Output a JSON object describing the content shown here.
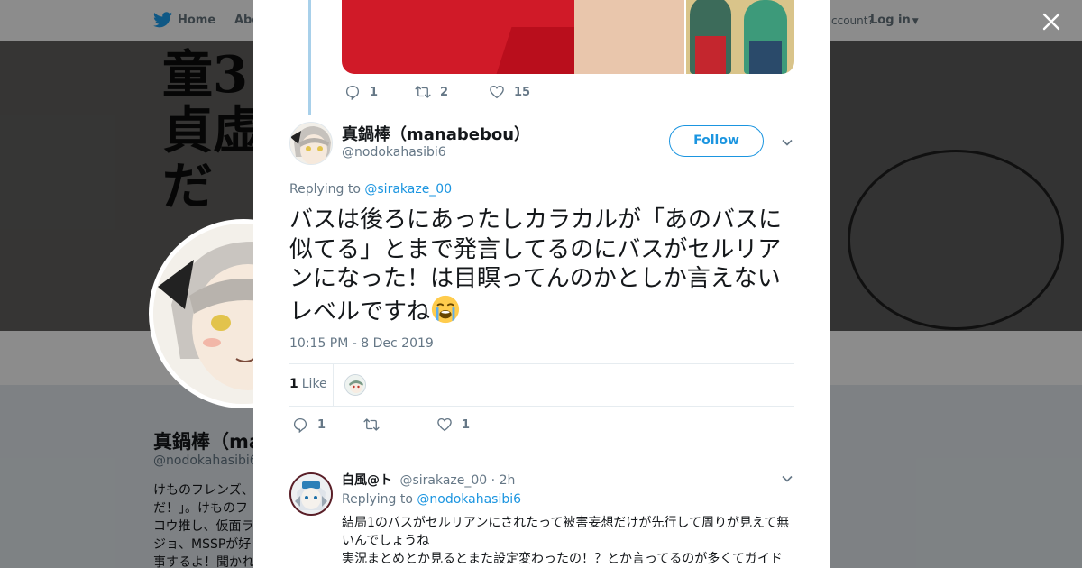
{
  "nav": {
    "home": "Home",
    "about": "Abo",
    "have_account": "ccount?",
    "login": "Log in"
  },
  "banner": {
    "kanji_lines": [
      "童3",
      "貞虚",
      "だ"
    ]
  },
  "background_profile": {
    "name": "真鍋棒（ma",
    "handle": "@nodokahasibi6",
    "bio": "けものフレンズ、だ！」。けものフコウ推し、仮面ラジョ、MSSPが好事するよ！聞かれ"
  },
  "previous_tweet": {
    "actions": {
      "replies": "1",
      "retweets": "2",
      "likes": "15"
    }
  },
  "tweet": {
    "author_name": "真鍋棒（manabebou）",
    "author_handle": "@nodokahasibi6",
    "follow_label": "Follow",
    "replying_prefix": "Replying to",
    "replying_handle": "@sirakaze_00",
    "text": "バスは後ろにあったしカラカルが「あのバスに似てる」とまで発言してるのにバスがセルリアンになった！は目瞑ってんのかとしか言えないレベルですね",
    "emoji": "loudly-crying-face",
    "timestamp": "10:15 PM - 8 Dec 2019",
    "like_count": "1",
    "like_label": "Like",
    "actions": {
      "replies": "1",
      "retweets": "",
      "likes": "1"
    }
  },
  "reply": {
    "author_name": "白風@ト",
    "author_handle": "@sirakaze_00",
    "separator": "·",
    "time": "2h",
    "replying_prefix": "Replying to",
    "replying_handle": "@nodokahasibi6",
    "text_line1": "結局1のバスがセルリアンにされたって被害妄想だけが先行して周りが見えて無いんでしょうね",
    "text_line2": "実況まとめとか見るとまた設定変わったの！？とか言ってるのが多くてガイド"
  },
  "colors": {
    "link": "#1b95e0",
    "text": "#14171a",
    "muted": "#657786",
    "thread_line": "#a8d0ea"
  }
}
